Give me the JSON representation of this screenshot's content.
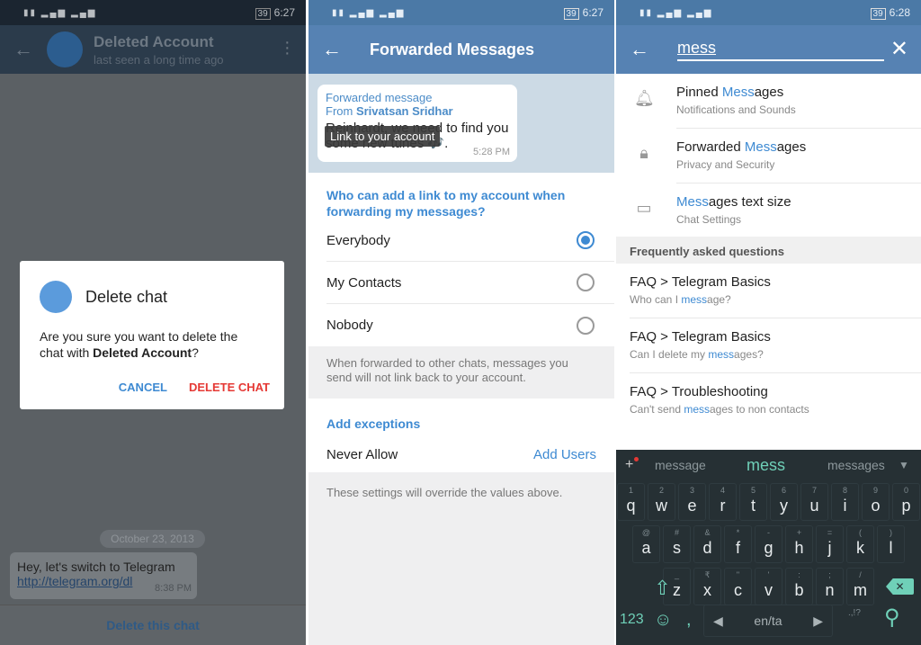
{
  "panel1": {
    "status": {
      "time": "6:27",
      "battery": "39"
    },
    "header": {
      "title": "Deleted Account",
      "subtitle": "last seen a long time ago"
    },
    "dialog": {
      "title": "Delete chat",
      "text_prefix": "Are you sure you want to delete the chat with ",
      "text_bold": "Deleted Account",
      "text_suffix": "?",
      "cancel": "CANCEL",
      "confirm": "DELETE CHAT",
      "confirm_color": "#e53935",
      "cancel_color": "#3e8ad2"
    },
    "date": "October 23, 2013",
    "message": {
      "text": "Hey, let's switch to Telegram",
      "link": "http://telegram.org/dl",
      "time": "8:38 PM"
    },
    "bottom_action": "Delete this chat"
  },
  "panel2": {
    "status": {
      "time": "6:27",
      "battery": "39"
    },
    "header": {
      "title": "Forwarded Messages"
    },
    "preview": {
      "line1": "Forwarded message",
      "from_label": "From ",
      "from_name": "Srivatsan Sridhar",
      "message": "Reinhardt, we need to find you some new tunes 🎶.",
      "time": "5:28 PM",
      "tooltip": "Link to your account"
    },
    "question": "Who can add a link to my account when forwarding my messages?",
    "options": [
      {
        "label": "Everybody",
        "selected": true
      },
      {
        "label": "My Contacts",
        "selected": false
      },
      {
        "label": "Nobody",
        "selected": false
      }
    ],
    "info": "When forwarded to other chats, messages you send will not link back to your account.",
    "exceptions_header": "Add exceptions",
    "never_allow": "Never Allow",
    "add_users": "Add Users",
    "footer": "These settings will override the values above."
  },
  "panel3": {
    "status": {
      "time": "6:28",
      "battery": "39"
    },
    "search_value": "mess",
    "results": [
      {
        "icon": "bell-icon",
        "pre": "Pinned ",
        "hl": "Mess",
        "post": "ages",
        "sub": "Notifications and Sounds"
      },
      {
        "icon": "lock-icon",
        "pre": "Forwarded ",
        "hl": "Mess",
        "post": "ages",
        "sub": "Privacy and Security"
      },
      {
        "icon": "chat-bubble-icon",
        "pre": "",
        "hl": "Mess",
        "post": "ages text size",
        "sub": "Chat Settings"
      }
    ],
    "faq_header": "Frequently asked questions",
    "faq": [
      {
        "title": "FAQ > Telegram Basics",
        "pre": "Who can I ",
        "hl": "mess",
        "post": "age?"
      },
      {
        "title": "FAQ > Telegram Basics",
        "pre": "Can I delete my ",
        "hl": "mess",
        "post": "ages?"
      },
      {
        "title": "FAQ > Troubleshooting",
        "pre": "Can't send ",
        "hl": "mess",
        "post": "ages to non contacts"
      }
    ],
    "keyboard": {
      "suggestions": [
        "message",
        "mess",
        "messages"
      ],
      "row1": [
        [
          "1",
          "q"
        ],
        [
          "2",
          "w"
        ],
        [
          "3",
          "e"
        ],
        [
          "4",
          "r"
        ],
        [
          "5",
          "t"
        ],
        [
          "6",
          "y"
        ],
        [
          "7",
          "u"
        ],
        [
          "8",
          "i"
        ],
        [
          "9",
          "o"
        ],
        [
          "0",
          "p"
        ]
      ],
      "row2": [
        [
          "@",
          "a"
        ],
        [
          "#",
          "s"
        ],
        [
          "&",
          "d"
        ],
        [
          "*",
          "f"
        ],
        [
          "-",
          "g"
        ],
        [
          "+",
          "h"
        ],
        [
          "=",
          "j"
        ],
        [
          "(",
          "k"
        ],
        [
          ")",
          "l"
        ]
      ],
      "row3": [
        [
          "_",
          "z"
        ],
        [
          "₹",
          "x"
        ],
        [
          "\"",
          "c"
        ],
        [
          "'",
          "v"
        ],
        [
          ":",
          "b"
        ],
        [
          ";",
          "n"
        ],
        [
          "/",
          "m"
        ]
      ],
      "numbers": "123",
      "comma": ",",
      "space": "en/ta",
      "punct": ".,!?",
      "accent": "#6fd0b8"
    }
  }
}
